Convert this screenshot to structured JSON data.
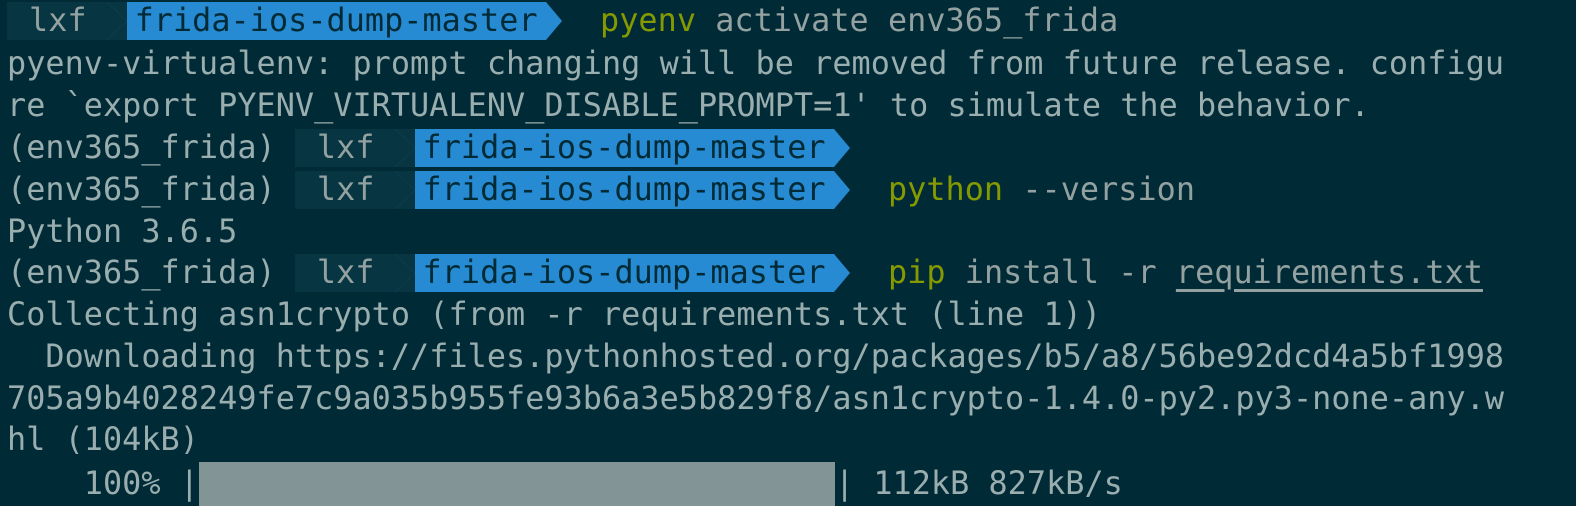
{
  "prompt": {
    "user": "lxf",
    "dir": "frida-ios-dump-master",
    "venv": "(env365_frida)"
  },
  "lines": {
    "l1_cmd": "pyenv",
    "l1_args": " activate env365_frida",
    "l2": "pyenv-virtualenv: prompt changing will be removed from future release. configu",
    "l3": "re `export PYENV_VIRTUALENV_DISABLE_PROMPT=1' to simulate the behavior.",
    "l5_cmd": "python",
    "l5_args": " --version",
    "l6": "Python 3.6.5",
    "l7_cmd": "pip",
    "l7_args": " install -r ",
    "l7_file": "requirements.txt",
    "l8": "Collecting asn1crypto (from -r requirements.txt (line 1))",
    "l9": "  Downloading https://files.pythonhosted.org/packages/b5/a8/56be92dcd4a5bf1998",
    "l10": "705a9b4028249fe7c9a035b955fe93b6a3e5b829f8/asn1crypto-1.4.0-py2.py3-none-any.w",
    "l11": "hl (104kB)"
  },
  "progress": {
    "percent_label": "    100% |",
    "fraction": 1.0,
    "tail": "| 112kB 827kB/s"
  },
  "colors": {
    "background": "#002b36",
    "prompt_user_bg": "#073642",
    "prompt_dir_bg": "#268bd2",
    "command": "#859900",
    "text": "#9aaeaf",
    "progress_fill": "#839496"
  }
}
